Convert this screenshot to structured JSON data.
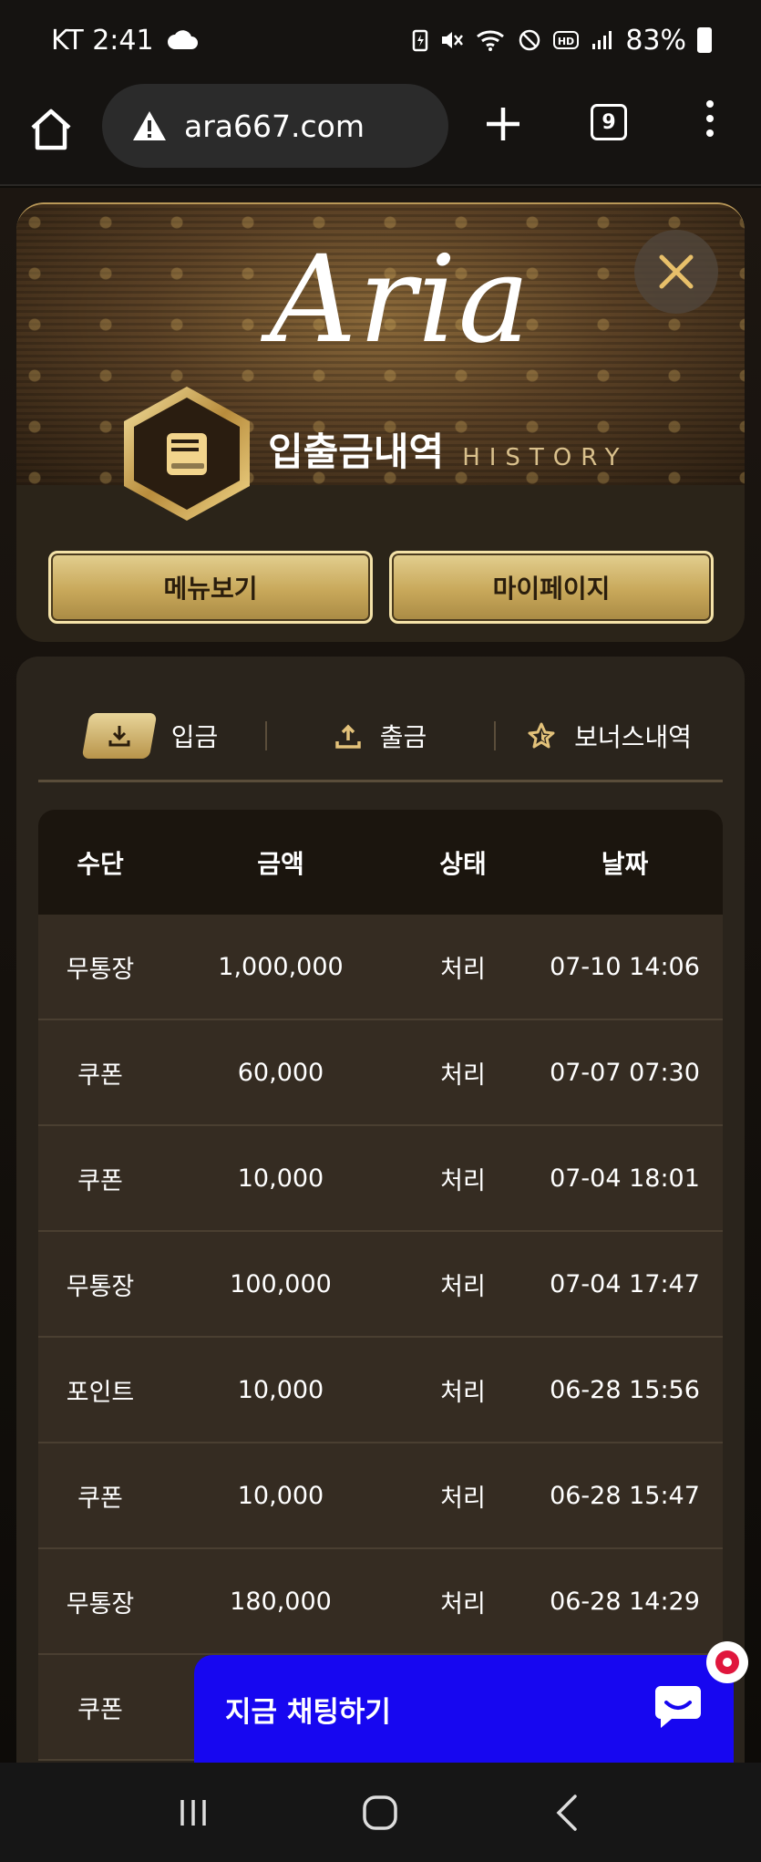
{
  "status_bar": {
    "carrier_time": "KT 2:41",
    "battery_percent": "83%",
    "icons": [
      "cloud-icon",
      "battery-saver-icon",
      "mute-icon",
      "wifi-icon",
      "do-not-disturb-icon",
      "hd-icon",
      "signal-icon",
      "battery-icon"
    ]
  },
  "browser": {
    "url": "ara667.com",
    "tab_count": "9",
    "icons": [
      "home-icon",
      "warning-icon",
      "plus-icon",
      "tabs-icon",
      "kebab-menu-icon"
    ]
  },
  "header": {
    "logo_text": "Aria",
    "title": "입출금내역",
    "subtitle": "HISTORY",
    "menu_button": "메뉴보기",
    "mypage_button": "마이페이지",
    "badge_icon": "book-icon",
    "close_icon": "close-icon"
  },
  "tabs": [
    {
      "label": "입금",
      "icon": "download-icon",
      "active": true
    },
    {
      "label": "출금",
      "icon": "upload-icon",
      "active": false
    },
    {
      "label": "보너스내역",
      "icon": "star-icon",
      "active": false
    }
  ],
  "table": {
    "headers": [
      "수단",
      "금액",
      "상태",
      "날짜"
    ],
    "rows": [
      {
        "method": "무통장",
        "amount": "1,000,000",
        "status": "처리",
        "date": "07-10 14:06"
      },
      {
        "method": "쿠폰",
        "amount": "60,000",
        "status": "처리",
        "date": "07-07 07:30"
      },
      {
        "method": "쿠폰",
        "amount": "10,000",
        "status": "처리",
        "date": "07-04 18:01"
      },
      {
        "method": "무통장",
        "amount": "100,000",
        "status": "처리",
        "date": "07-04 17:47"
      },
      {
        "method": "포인트",
        "amount": "10,000",
        "status": "처리",
        "date": "06-28 15:56"
      },
      {
        "method": "쿠폰",
        "amount": "10,000",
        "status": "처리",
        "date": "06-28 15:47"
      },
      {
        "method": "무통장",
        "amount": "180,000",
        "status": "처리",
        "date": "06-28 14:29"
      },
      {
        "method": "쿠폰",
        "amount": "",
        "status": "",
        "date": ""
      }
    ]
  },
  "chat": {
    "label": "지금 채팅하기",
    "icon": "chat-bubble-icon"
  },
  "nav": {
    "icons": [
      "recent-apps-icon",
      "home-nav-icon",
      "back-icon"
    ]
  }
}
